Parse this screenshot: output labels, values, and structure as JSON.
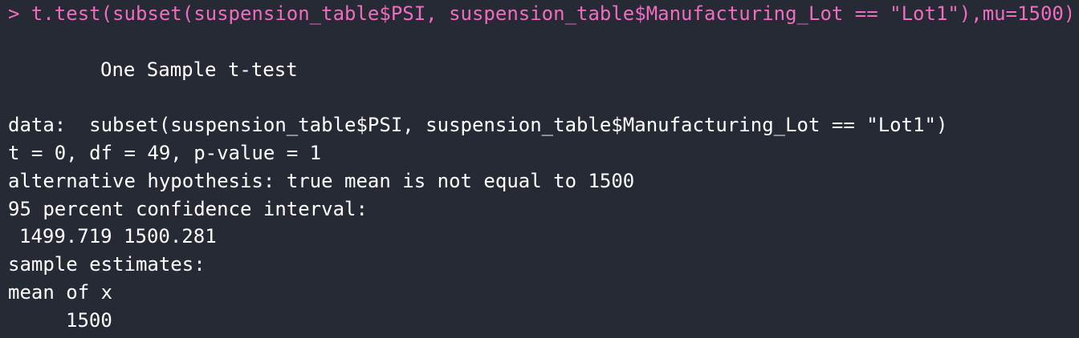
{
  "console": {
    "command_line": "> t.test(subset(suspension_table$PSI, suspension_table$Manufacturing_Lot == \"Lot1\"),mu=1500)",
    "title": "One Sample t-test",
    "data_line": "data:  subset(suspension_table$PSI, suspension_table$Manufacturing_Lot == \"Lot1\")",
    "stats_line": "t = 0, df = 49, p-value = 1",
    "alternative_line": "alternative hypothesis: true mean is not equal to 1500",
    "ci_label": "95 percent confidence interval:",
    "ci_values": "1499.719 1500.281",
    "estimates_label": "sample estimates:",
    "mean_label": "mean of x",
    "mean_value": "1500"
  },
  "colors": {
    "background": "#262a34",
    "command_text": "#f06cc0",
    "output_text": "#ffffff"
  }
}
